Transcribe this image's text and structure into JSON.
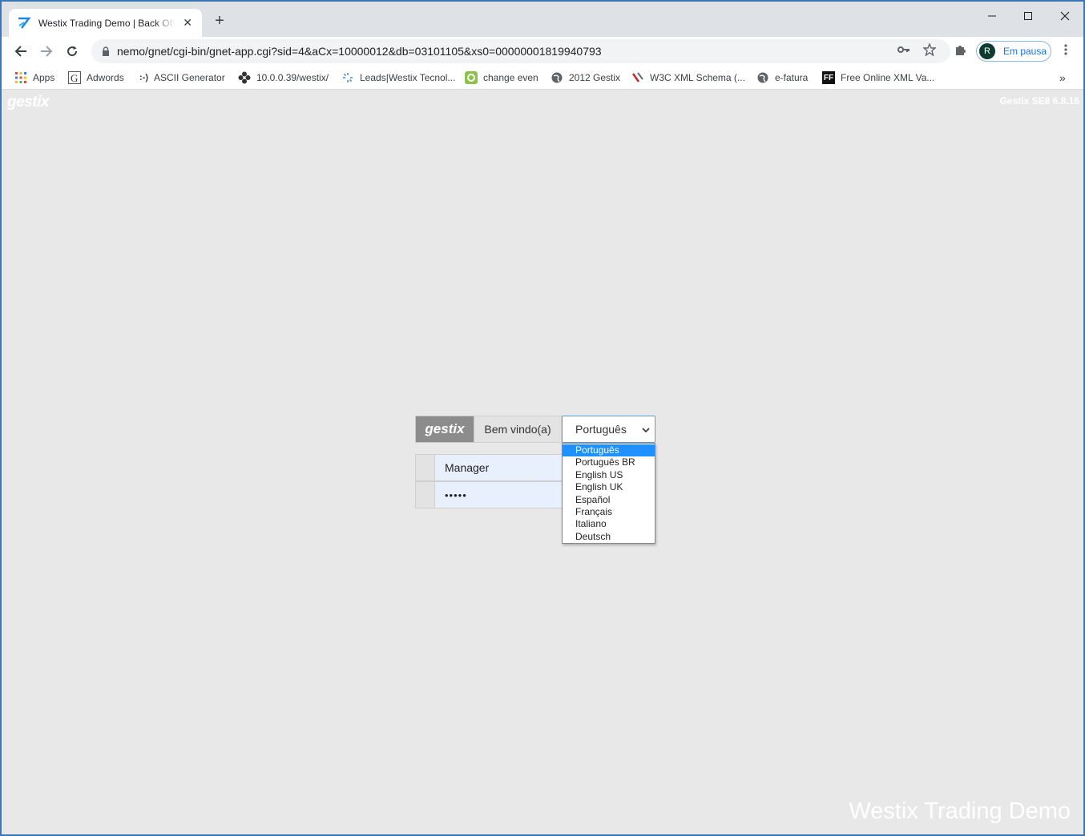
{
  "browser": {
    "tab_title": "Westix Trading Demo | Back Office",
    "url": "nemo/gnet/cgi-bin/gnet-app.cgi?sid=4&aCx=10000012&db=03101105&xs0=00000001819940793",
    "profile_initial": "R",
    "profile_label": "Em pausa"
  },
  "bookmarks": [
    {
      "label": "Apps",
      "icon": "apps-grid-icon"
    },
    {
      "label": "Adwords",
      "icon": "google-icon"
    },
    {
      "label": "ASCII Generator",
      "icon": "smiley-text-icon",
      "glyph": ":-)"
    },
    {
      "label": "10.0.0.39/westix/",
      "icon": "flower-icon"
    },
    {
      "label": "Leads|Westix Tecnol...",
      "icon": "spinner-icon"
    },
    {
      "label": "change even",
      "icon": "green-q-icon"
    },
    {
      "label": "2012 Gestix",
      "icon": "globe-icon"
    },
    {
      "label": "W3C XML Schema (...",
      "icon": "w3c-icon"
    },
    {
      "label": "e-fatura",
      "icon": "globe-icon"
    },
    {
      "label": "Free Online XML Va...",
      "icon": "ff-icon",
      "glyph": "FF"
    }
  ],
  "page": {
    "logo": "gestix",
    "version": "Gestix SE8 6.8.16",
    "footer_brand": "Westix Trading Demo"
  },
  "login": {
    "logo": "gestix",
    "welcome": "Bem vindo(a)",
    "language_selected": "Português",
    "username": "Manager",
    "password_masked": "•••••"
  },
  "language_options": [
    "Português",
    "Português BR",
    "English US",
    "English UK",
    "Español",
    "Français",
    "Italiano",
    "Deutsch"
  ],
  "colors": {
    "page_bg": "#e8e8e8",
    "selected_option": "#1e90ff",
    "autofill_bg": "#e8f0fe",
    "frame": "#3a78b5"
  }
}
